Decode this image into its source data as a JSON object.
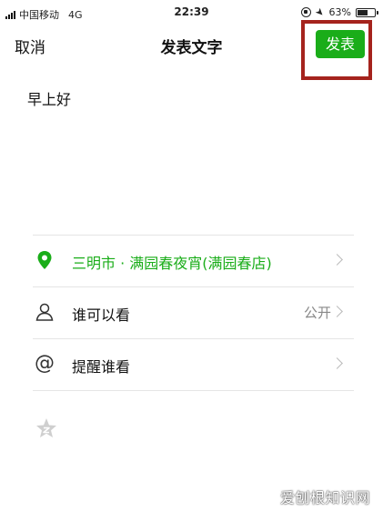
{
  "status_bar": {
    "carrier": "中国移动",
    "network": "4G",
    "time": "22:39",
    "battery_percent": "63%",
    "battery_level": 0.63,
    "icons": [
      "signal-icon",
      "rotation-lock-icon",
      "location-arrow-icon",
      "battery-icon"
    ]
  },
  "nav": {
    "cancel_label": "取消",
    "title": "发表文字",
    "publish_label": "发表"
  },
  "compose": {
    "text": "早上好"
  },
  "options": {
    "location": {
      "label": "三明市 · 满园春夜宵(满园春店)",
      "icon": "location-pin-icon"
    },
    "visibility": {
      "label": "谁可以看",
      "value": "公开",
      "icon": "person-icon"
    },
    "mention": {
      "label": "提醒谁看",
      "icon": "at-icon"
    }
  },
  "watermark": "爱刨根知识网",
  "colors": {
    "accent_green": "#1aad19",
    "highlight_red": "#a5231d",
    "divider": "#e5e5e5"
  }
}
